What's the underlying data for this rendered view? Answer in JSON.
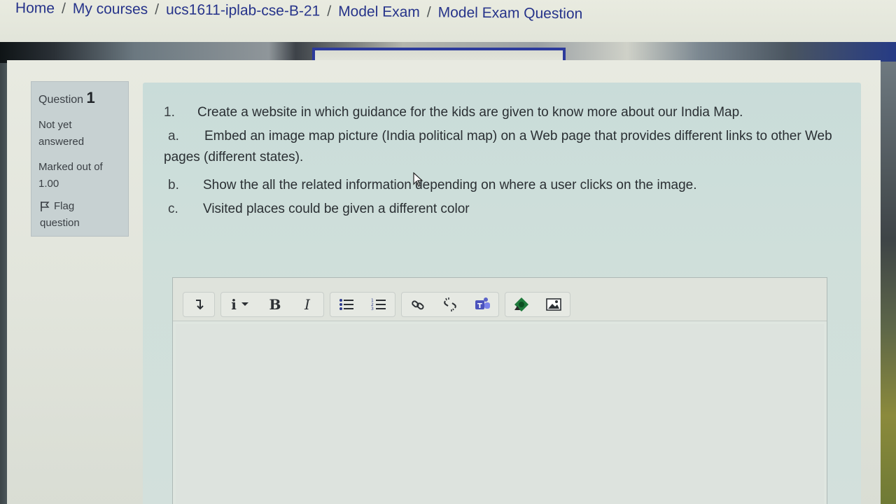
{
  "breadcrumb": {
    "items": [
      "Home",
      "My courses",
      "ucs1611-iplab-cse-B-21",
      "Model Exam",
      "Model Exam Question"
    ],
    "separator": "/"
  },
  "question_info": {
    "label": "Question",
    "number": "1",
    "state_line1": "Not yet",
    "state_line2": "answered",
    "grade_line1": "Marked out of",
    "grade_line2": "1.00",
    "flag_line1": "Flag",
    "flag_line2": "question"
  },
  "question": {
    "items": [
      {
        "marker": "1.",
        "text": "Create a website in which guidance for the kids are given to know more about our India Map."
      },
      {
        "marker": "a.",
        "text": "Embed an image map picture (India political map) on a Web page that provides different links to other Web pages (different states)."
      },
      {
        "marker": "b.",
        "text": "Show the all the related information depending on where a user clicks on the image."
      },
      {
        "marker": "c.",
        "text": "Visited places could be given a different color"
      }
    ]
  },
  "editor": {
    "toolbar": [
      {
        "name": "toolbar-toggle-icon",
        "glyph": "↴"
      },
      {
        "name": "paragraph-style-icon",
        "glyph": "i ▾"
      },
      {
        "name": "bold-icon",
        "glyph": "B"
      },
      {
        "name": "italic-icon",
        "glyph": "I"
      },
      {
        "name": "unordered-list-icon",
        "glyph": "☰"
      },
      {
        "name": "ordered-list-icon",
        "glyph": "☰"
      },
      {
        "name": "link-icon",
        "glyph": "🔗"
      },
      {
        "name": "unlink-icon",
        "glyph": "⛓"
      },
      {
        "name": "teams-icon",
        "glyph": "T"
      },
      {
        "name": "media-icon",
        "glyph": "◆"
      },
      {
        "name": "image-icon",
        "glyph": "▣"
      }
    ],
    "content": ""
  },
  "colors": {
    "breadcrumb_link": "#26338a",
    "content_bg": "#c9dcd9",
    "info_bg": "#c7d1d2",
    "banner_accent": "#2c3a9c"
  }
}
